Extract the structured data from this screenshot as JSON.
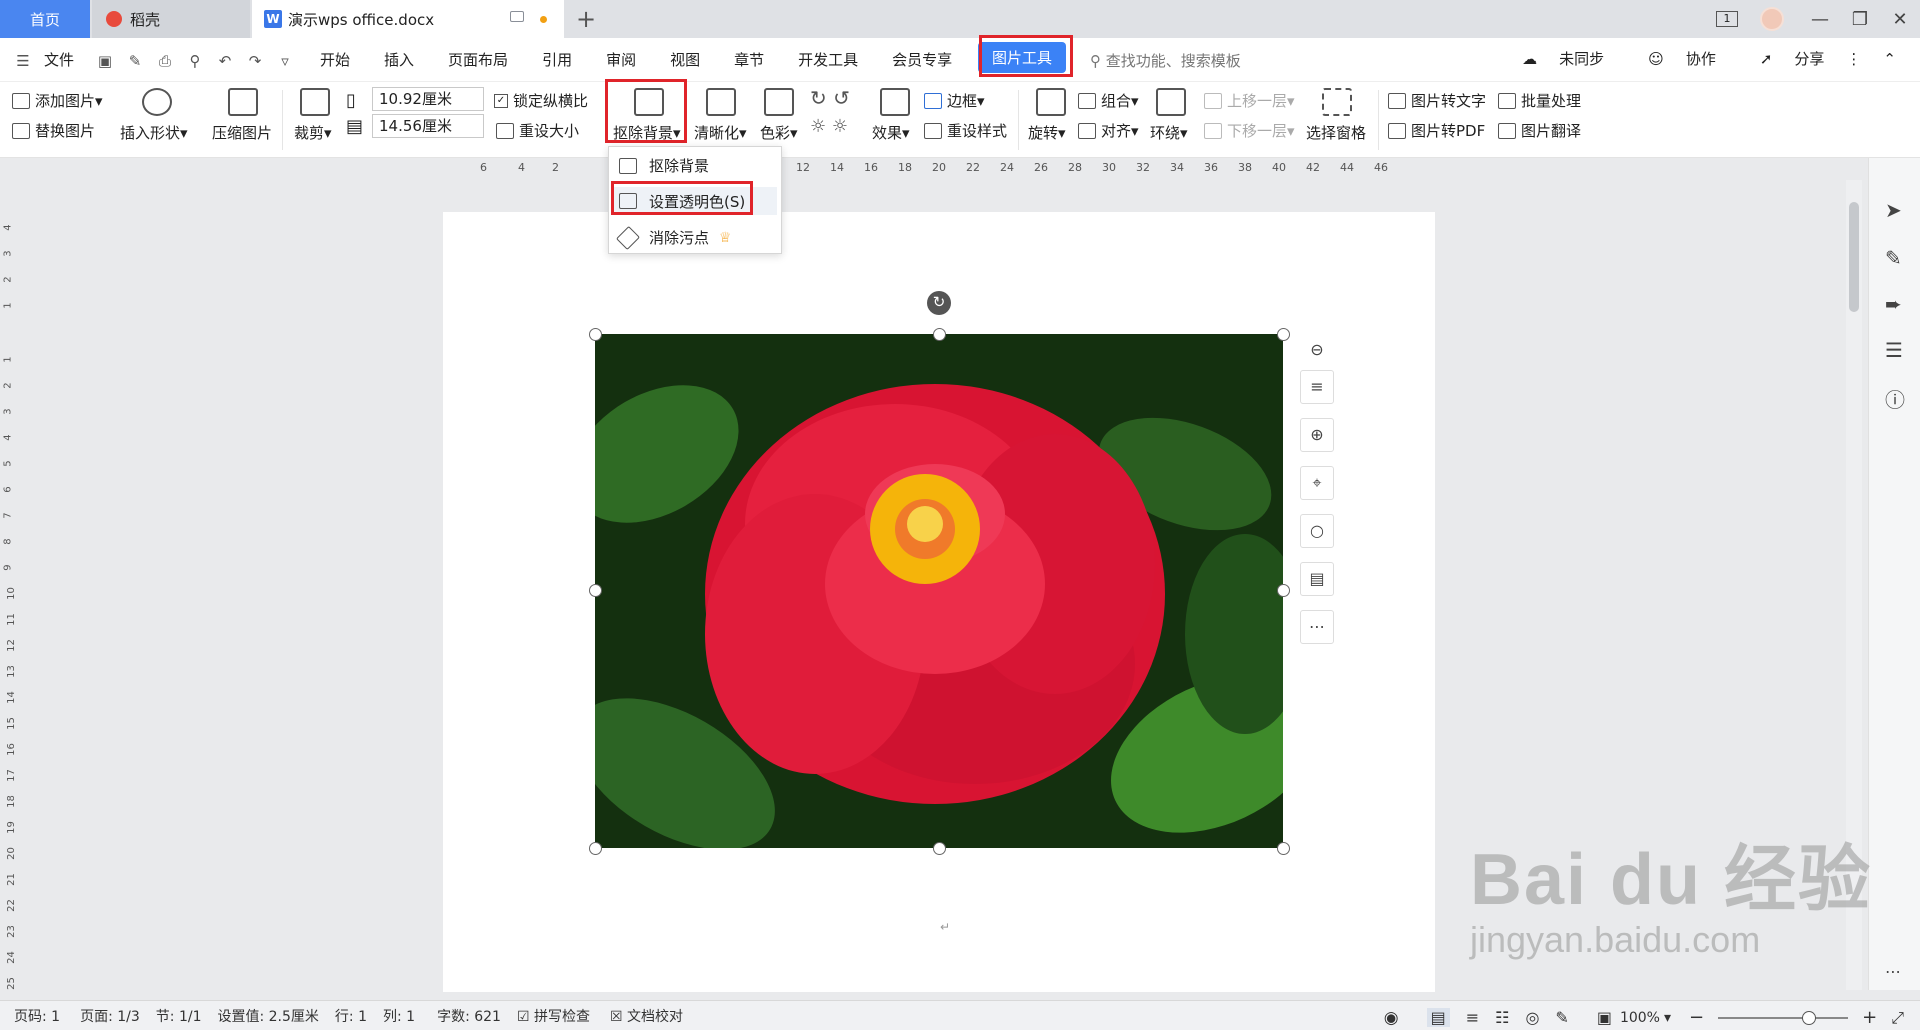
{
  "tabs": {
    "home": "首页",
    "daoke": "稻壳",
    "doc": "演示wps office.docx"
  },
  "menu": {
    "file": "文件",
    "items": [
      "开始",
      "插入",
      "页面布局",
      "引用",
      "审阅",
      "视图",
      "章节",
      "开发工具",
      "会员专享"
    ],
    "active_tab": "图片工具",
    "search_placeholder": "查找功能、搜索模板",
    "sync": "未同步",
    "collab": "协作",
    "share": "分享"
  },
  "ribbon": {
    "add_picture": "添加图片",
    "replace_picture": "替换图片",
    "insert_shape": "插入形状",
    "compress_picture": "压缩图片",
    "crop": "裁剪",
    "width_value": "10.92厘米",
    "height_value": "14.56厘米",
    "lock_ratio": "锁定纵横比",
    "reset_size": "重设大小",
    "remove_bg": "抠除背景",
    "sharpen": "清晰化",
    "color": "色彩",
    "effects": "效果",
    "border": "边框",
    "reset_style": "重设样式",
    "rotate": "旋转",
    "group": "组合",
    "align": "对齐",
    "wrap": "环绕",
    "bring_forward": "上移一层",
    "send_backward": "下移一层",
    "selection_pane": "选择窗格",
    "pic_to_text": "图片转文字",
    "pic_to_pdf": "图片转PDF",
    "batch": "批量处理",
    "translate": "图片翻译"
  },
  "dropdown": {
    "items": [
      "抠除背景",
      "设置透明色(S)",
      "消除污点"
    ]
  },
  "ruler_h": [
    "6",
    "4",
    "2",
    "12",
    "14",
    "16",
    "18",
    "20",
    "22",
    "24",
    "26",
    "28",
    "30",
    "32",
    "34",
    "36",
    "38",
    "40",
    "42",
    "44",
    "46"
  ],
  "ruler_v": [
    "4",
    "3",
    "2",
    "1",
    "1",
    "2",
    "3",
    "4",
    "5",
    "6",
    "7",
    "8",
    "9",
    "10",
    "11",
    "12",
    "13",
    "14",
    "15",
    "16",
    "17",
    "18",
    "19",
    "20",
    "21",
    "22",
    "23",
    "24",
    "25"
  ],
  "status": {
    "page_code": "页码: 1",
    "pages": "页面: 1/3",
    "section": "节: 1/1",
    "setting": "设置值: 2.5厘米",
    "row": "行: 1",
    "col": "列: 1",
    "words": "字数: 621",
    "spellcheck": "拼写检查",
    "proofread": "文档校对",
    "zoom": "100%"
  },
  "watermark": {
    "main": "Bai du 经验",
    "sub": "jingyan.baidu.com"
  },
  "colors": {
    "accent": "#3b82f6",
    "highlight_border": "#e0242a",
    "home_tab": "#4a86f0"
  }
}
